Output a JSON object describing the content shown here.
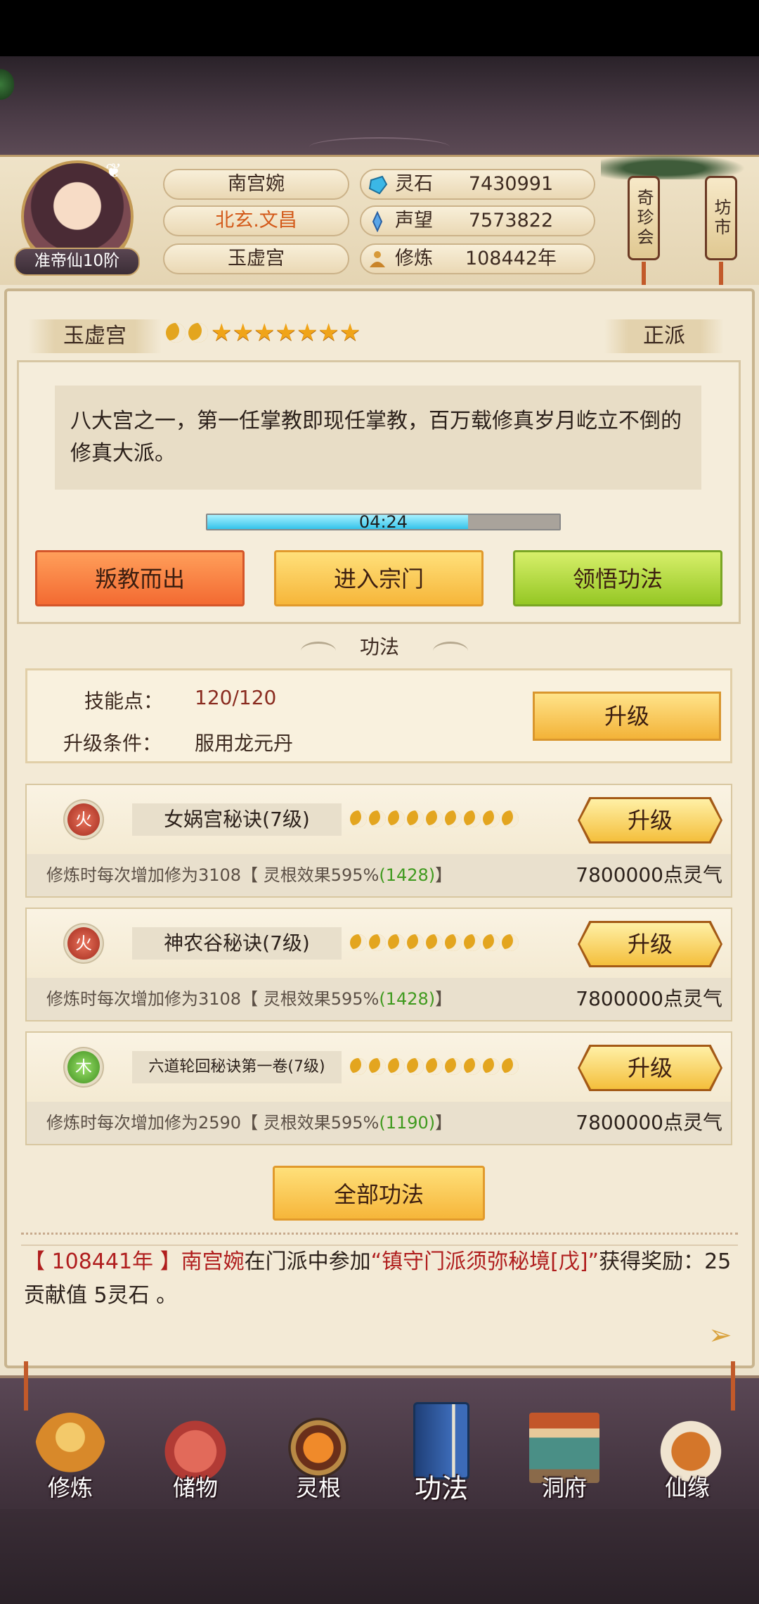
{
  "player": {
    "name": "南宫婉",
    "title": "北玄.文昌",
    "sect": "玉虚宫",
    "rank": "准帝仙10阶"
  },
  "stats": [
    {
      "label": "灵石",
      "value": "7430991",
      "icon": "spirit-stone-icon"
    },
    {
      "label": "声望",
      "value": "7573822",
      "icon": "prestige-icon"
    },
    {
      "label": "修炼",
      "value": "108442年",
      "icon": "meditation-icon"
    }
  ],
  "side_buttons": {
    "treasure": "奇珍会",
    "market": "坊市"
  },
  "sect_panel": {
    "name": "玉虚宫",
    "alignment": "正派",
    "rating": {
      "moons": 2,
      "stars": 7
    },
    "description": "八大宫之一，第一任掌教即现任掌教，百万载修真岁月屹立不倒的修真大派。",
    "timer": "04:24",
    "timer_progress": 0.74,
    "buttons": {
      "betray": "叛教而出",
      "enter": "进入宗门",
      "comprehend": "领悟功法"
    }
  },
  "skills_section": {
    "title": "功法",
    "skill_points_label": "技能点：",
    "skill_points_value": "120/120",
    "upgrade_condition_label": "升级条件：",
    "upgrade_condition_value": "服用龙元丹",
    "upgrade_button": "升级"
  },
  "skill_cards": [
    {
      "element": "火",
      "element_type": "fire",
      "name": "女娲宫秘诀(7级)",
      "moons": 9,
      "button": "升级",
      "desc_prefix": "修炼时每次增加修为3108【 灵根效果595%",
      "desc_bonus": "(1428)",
      "desc_suffix": "】",
      "cost": "7800000点灵气"
    },
    {
      "element": "火",
      "element_type": "fire",
      "name": "神农谷秘诀(7级)",
      "moons": 9,
      "button": "升级",
      "desc_prefix": "修炼时每次增加修为3108【 灵根效果595%",
      "desc_bonus": "(1428)",
      "desc_suffix": "】",
      "cost": "7800000点灵气"
    },
    {
      "element": "木",
      "element_type": "wood",
      "name": "六道轮回秘诀第一卷(7级)",
      "moons": 9,
      "button": "升级",
      "desc_prefix": "修炼时每次增加修为2590【 灵根效果595%",
      "desc_bonus": "(1190)",
      "desc_suffix": "】",
      "cost": "7800000点灵气"
    }
  ],
  "all_skills_button": "全部功法",
  "log": {
    "year": "【 108441年 】",
    "name": "南宫婉",
    "mid": "在门派中参加",
    "event": "“镇守门派须弥秘境[戊]”",
    "reward": "获得奖励：25贡献值 5灵石 。"
  },
  "nav": [
    {
      "label": "修炼",
      "icon": "cultivate-icon"
    },
    {
      "label": "储物",
      "icon": "storage-bag-icon"
    },
    {
      "label": "灵根",
      "icon": "spirit-root-icon"
    },
    {
      "label": "功法",
      "icon": "skill-book-icon",
      "active": true
    },
    {
      "label": "洞府",
      "icon": "cave-dwelling-icon"
    },
    {
      "label": "仙缘",
      "icon": "immortal-fate-icon"
    }
  ],
  "colors": {
    "accent_red": "#b01e1e",
    "bonus_green": "#3f9a1e",
    "panel_bg": "#f3ead6",
    "nav_bg": "#4a3a45"
  }
}
